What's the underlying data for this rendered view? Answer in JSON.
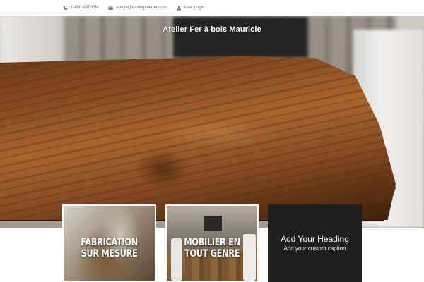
{
  "topbar": {
    "phone": "1-800-987-654",
    "email": "admin@totalwptheme.com",
    "login": "User Login"
  },
  "hero": {
    "title": "Atelier Fer à bois Mauricie"
  },
  "cards": [
    {
      "line1": "FABRICATION",
      "line2": "SUR MESURE"
    },
    {
      "line1": "MOBILIER EN",
      "line2": "TOUT GENRE"
    },
    {
      "heading": "Add Your Heading",
      "caption": "Add your custom caption"
    }
  ],
  "icons": {
    "phone": "phone-icon",
    "email": "envelope-icon",
    "login": "user-icon"
  },
  "colors": {
    "card_dark": "#1e1e1e",
    "text_muted": "#666666"
  }
}
